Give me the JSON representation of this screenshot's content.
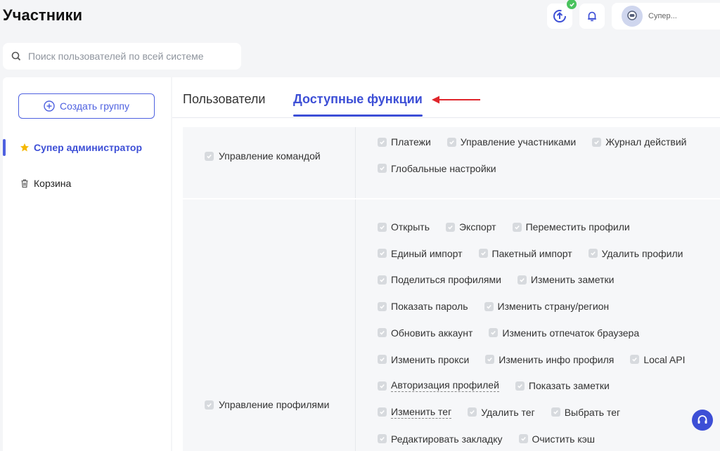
{
  "page": {
    "title": "Участники"
  },
  "header": {
    "user_name": "Супер..."
  },
  "search": {
    "placeholder": "Поиск пользователей по всей системе",
    "value": ""
  },
  "sidebar": {
    "create_button": "Создать группу",
    "groups": [
      {
        "label": "Супер администратор",
        "active": true,
        "icon": "star-icon"
      },
      {
        "label": "Корзина",
        "active": false,
        "icon": "trash-icon"
      }
    ]
  },
  "tabs": [
    {
      "label": "Пользователи",
      "active": false
    },
    {
      "label": "Доступные функции",
      "active": true
    }
  ],
  "permissions": {
    "team": {
      "label": "Управление командой",
      "lines": [
        [
          "Платежи",
          "Управление участниками",
          "Журнал действий"
        ],
        [
          "Глобальные настройки"
        ]
      ]
    },
    "profiles": {
      "label": "Управление профилями",
      "lines": [
        [
          "Открыть",
          "Экспорт",
          "Переместить профили"
        ],
        [
          "Единый импорт",
          "Пакетный импорт",
          "Удалить профили"
        ],
        [
          "Поделиться профилями",
          "Изменить заметки"
        ],
        [
          "Показать пароль",
          "Изменить страну/регион"
        ],
        [
          "Обновить аккаунт",
          "Изменить отпечаток браузера"
        ],
        [
          "Изменить прокси",
          "Изменить инфо профиля",
          "Local API"
        ],
        [
          "Авторизация профилей",
          "Показать заметки"
        ],
        [
          "Изменить тег",
          "Удалить тег",
          "Выбрать тег"
        ],
        [
          "Редактировать закладку",
          "Очистить кэш"
        ]
      ]
    }
  },
  "colors": {
    "accent": "#3d4fd6",
    "arrow": "#e0262b",
    "checkbox": "#d7dade",
    "badge": "#49c25d"
  }
}
